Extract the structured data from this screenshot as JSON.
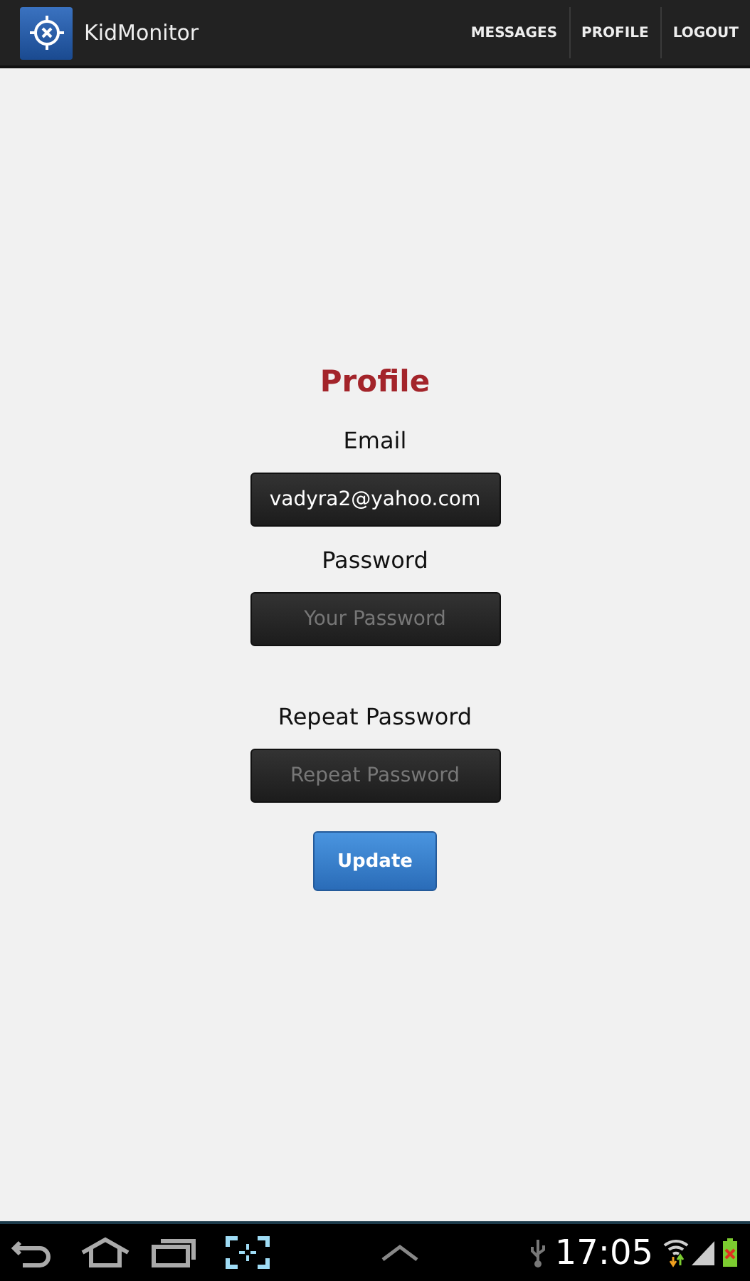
{
  "app_bar": {
    "title": "KidMonitor",
    "menu": [
      {
        "label": "MESSAGES"
      },
      {
        "label": "PROFILE"
      },
      {
        "label": "LOGOUT"
      }
    ]
  },
  "form": {
    "title": "Profile",
    "fields": [
      {
        "label": "Email",
        "value": "vadyra2@yahoo.com"
      },
      {
        "label": "Password",
        "placeholder": "Your Password"
      },
      {
        "label": "Repeat Password",
        "placeholder": "Repeat Password"
      }
    ],
    "button": "Update"
  },
  "system_bar": {
    "time": "17:05"
  }
}
